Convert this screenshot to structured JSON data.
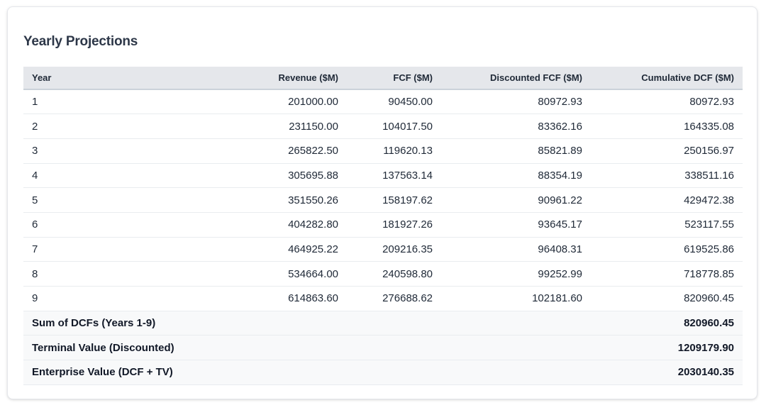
{
  "section": {
    "title": "Yearly Projections"
  },
  "table": {
    "headers": [
      "Year",
      "Revenue ($M)",
      "FCF ($M)",
      "Discounted FCF ($M)",
      "Cumulative DCF ($M)"
    ],
    "rows": [
      [
        "1",
        "201000.00",
        "90450.00",
        "80972.93",
        "80972.93"
      ],
      [
        "2",
        "231150.00",
        "104017.50",
        "83362.16",
        "164335.08"
      ],
      [
        "3",
        "265822.50",
        "119620.13",
        "85821.89",
        "250156.97"
      ],
      [
        "4",
        "305695.88",
        "137563.14",
        "88354.19",
        "338511.16"
      ],
      [
        "5",
        "351550.26",
        "158197.62",
        "90961.22",
        "429472.38"
      ],
      [
        "6",
        "404282.80",
        "181927.26",
        "93645.17",
        "523117.55"
      ],
      [
        "7",
        "464925.22",
        "209216.35",
        "96408.31",
        "619525.86"
      ],
      [
        "8",
        "534664.00",
        "240598.80",
        "99252.99",
        "718778.85"
      ],
      [
        "9",
        "614863.60",
        "276688.62",
        "102181.60",
        "820960.45"
      ]
    ],
    "summary": [
      {
        "label": "Sum of DCFs (Years 1-9)",
        "value": "820960.45"
      },
      {
        "label": "Terminal Value (Discounted)",
        "value": "1209179.90"
      },
      {
        "label": "Enterprise Value (DCF + TV)",
        "value": "2030140.35"
      }
    ]
  }
}
